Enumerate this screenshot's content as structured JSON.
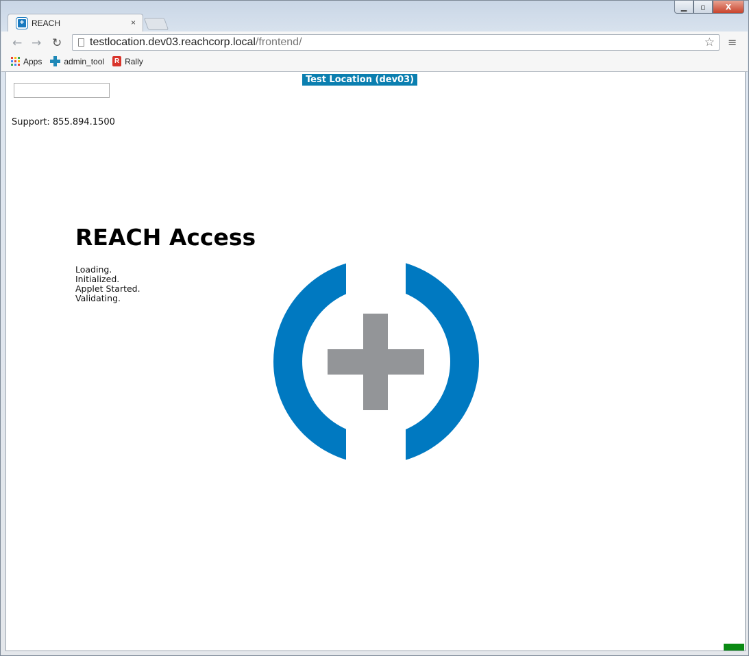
{
  "browser": {
    "tab": {
      "title": "REACH",
      "close_glyph": "×"
    },
    "address": {
      "host": "testlocation.dev03.reachcorp.local",
      "path": "/frontend/"
    },
    "bookmarks": [
      {
        "label": "Apps",
        "icon": "apps-grid-icon"
      },
      {
        "label": "admin_tool",
        "icon": "puzzle-icon"
      },
      {
        "label": "Rally",
        "icon": "rally-icon"
      }
    ],
    "nav": {
      "back_glyph": "←",
      "forward_glyph": "→",
      "reload_glyph": "↻",
      "star_glyph": "☆",
      "menu_glyph": "≡"
    },
    "window_controls": {
      "minimize": "▁",
      "maximize": "▫",
      "close": "X"
    }
  },
  "page": {
    "environment_badge": "Test Location (dev03)",
    "top_input": {
      "value": "",
      "placeholder": ""
    },
    "support_text": "Support: 855.894.1500",
    "app_title": "REACH Access",
    "status_lines": [
      "Loading.",
      "Initialized.",
      "Applet Started.",
      "Validating."
    ],
    "colors": {
      "brand_blue": "#0079c1",
      "cross_gray": "#939598",
      "badge_blue": "#0b7fb0",
      "indicator_green": "#0a8a13"
    }
  }
}
